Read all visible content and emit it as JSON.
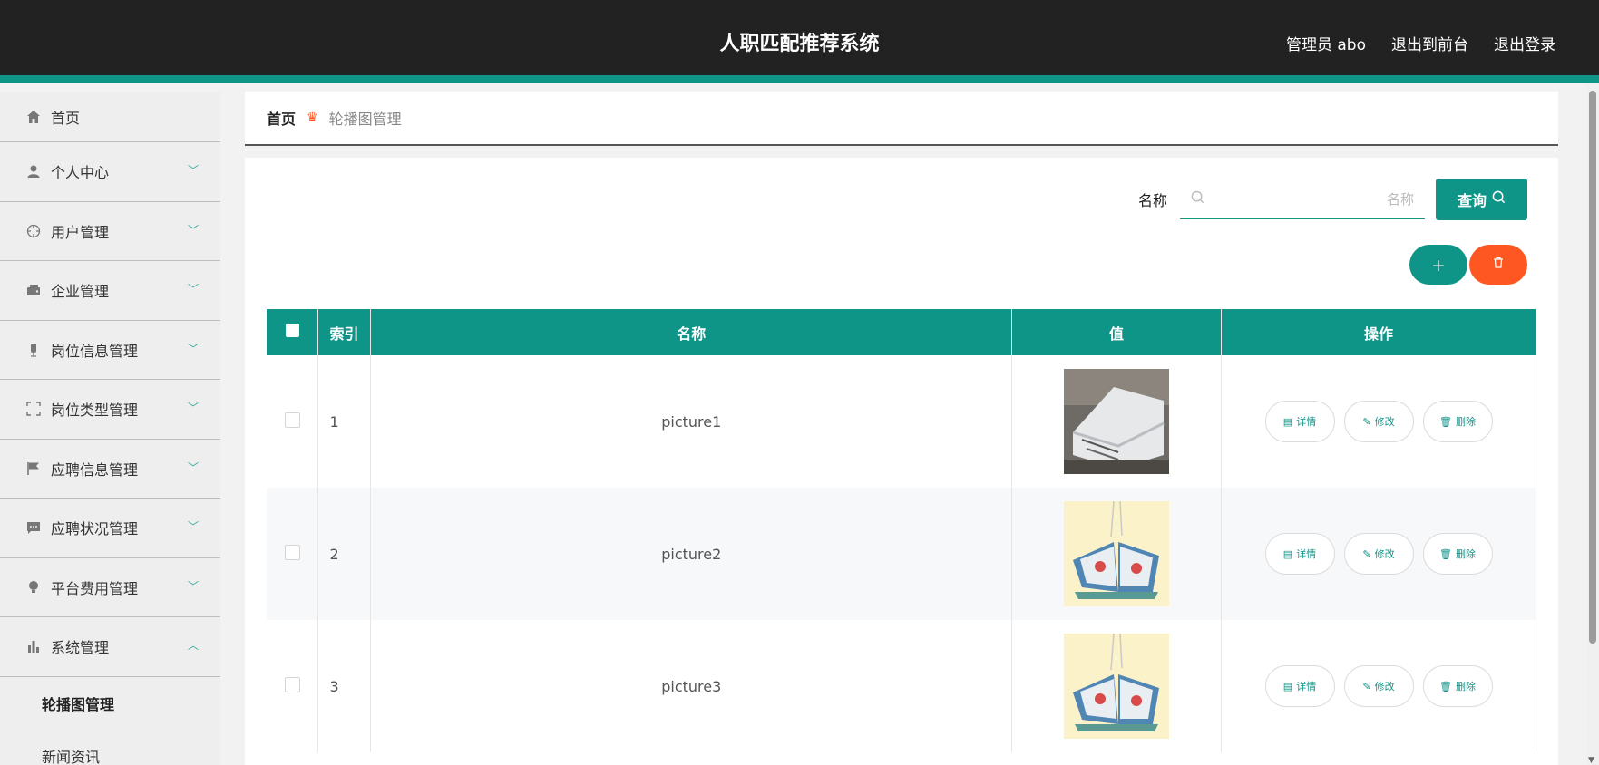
{
  "header": {
    "title": "人职匹配推荐系统",
    "user_label": "管理员 abo",
    "back_front": "退出到前台",
    "logout": "退出登录"
  },
  "sidebar": {
    "items": [
      {
        "label": "首页",
        "icon": "home-icon"
      },
      {
        "label": "个人中心",
        "icon": "user-icon"
      },
      {
        "label": "用户管理",
        "icon": "target-icon"
      },
      {
        "label": "企业管理",
        "icon": "wallet-icon"
      },
      {
        "label": "岗位信息管理",
        "icon": "mic-icon"
      },
      {
        "label": "岗位类型管理",
        "icon": "frame-icon"
      },
      {
        "label": "应聘信息管理",
        "icon": "flag-icon"
      },
      {
        "label": "应聘状况管理",
        "icon": "chat-icon"
      },
      {
        "label": "平台费用管理",
        "icon": "bulb-icon"
      },
      {
        "label": "系统管理",
        "icon": "bar-chart-icon"
      }
    ],
    "sub_items": [
      "轮播图管理",
      "新闻资讯"
    ]
  },
  "breadcrumb": {
    "home": "首页",
    "current": "轮播图管理"
  },
  "search": {
    "label": "名称",
    "placeholder": "名称",
    "button": "查询"
  },
  "table": {
    "headers": [
      "索引",
      "名称",
      "值",
      "操作"
    ],
    "rows": [
      {
        "index": "1",
        "name": "picture1"
      },
      {
        "index": "2",
        "name": "picture2"
      },
      {
        "index": "3",
        "name": "picture3"
      }
    ],
    "ops": {
      "detail": "详情",
      "edit": "修改",
      "delete": "删除"
    }
  },
  "colors": {
    "accent": "#0f9488",
    "danger": "#ff5722",
    "header_bg": "#222222"
  }
}
